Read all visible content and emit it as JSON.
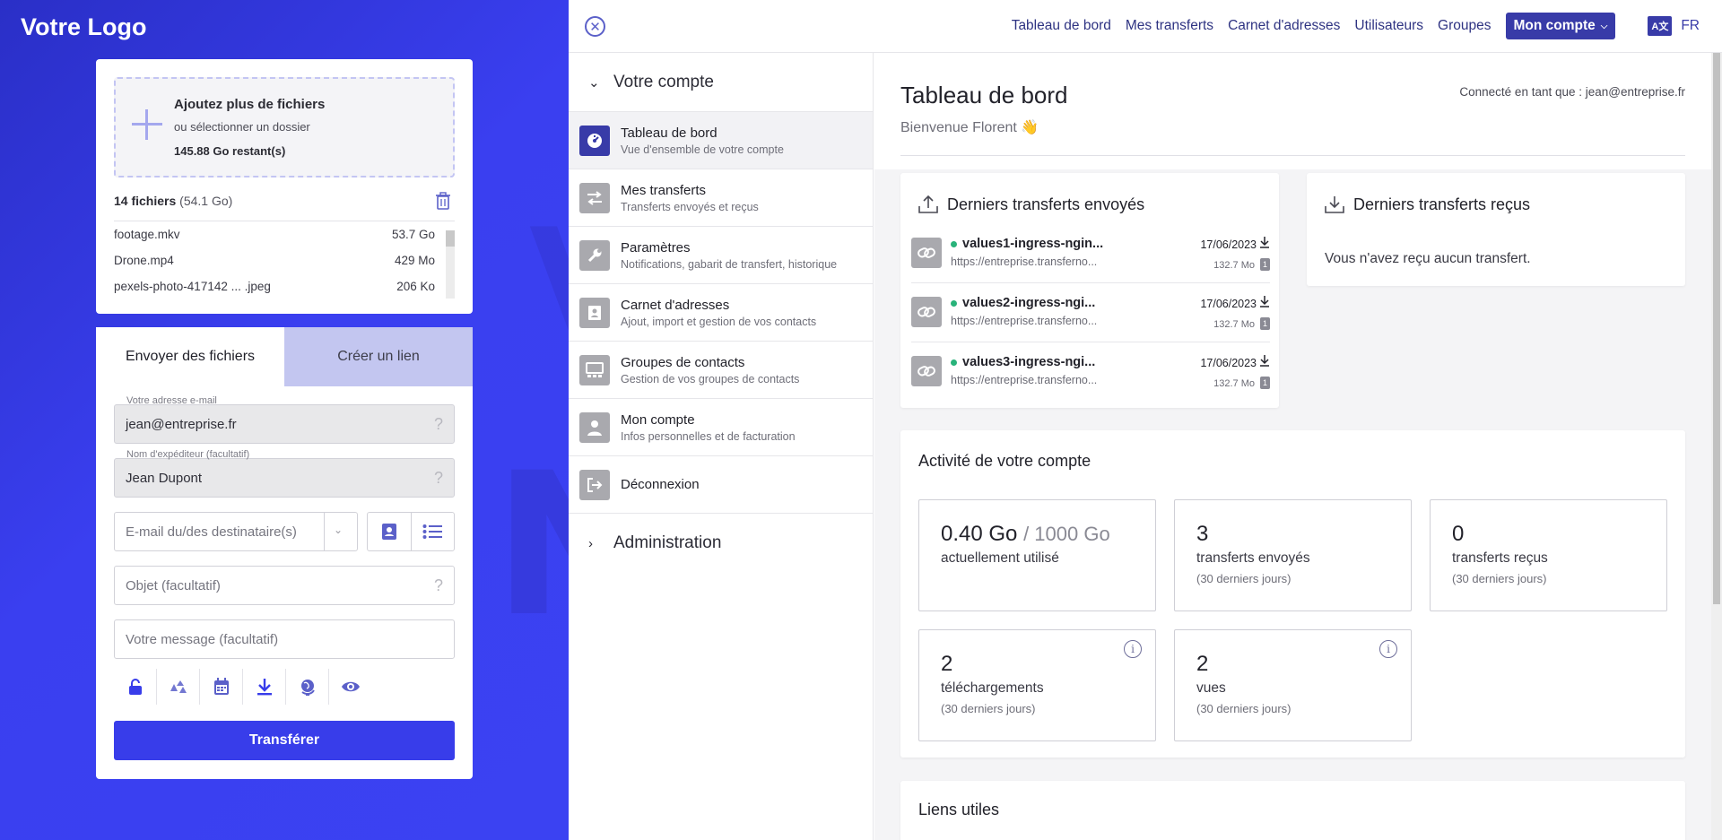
{
  "brand": {
    "logo": "Votre Logo"
  },
  "upload": {
    "title": "Ajoutez plus de fichiers",
    "subtitle": "ou sélectionner un dossier",
    "remaining": "145.88 Go restant(s)",
    "count_bold": "14 fichiers",
    "count_size": "(54.1 Go)",
    "files": [
      {
        "name": "footage.mkv",
        "size": "53.7 Go"
      },
      {
        "name": "Drone.mp4",
        "size": "429 Mo"
      },
      {
        "name": "pexels-photo-417142 ... .jpeg",
        "size": "206 Ko"
      }
    ]
  },
  "send": {
    "tab_send": "Envoyer des fichiers",
    "tab_link": "Créer un lien",
    "email_label": "Votre adresse e-mail",
    "email_value": "jean@entreprise.fr",
    "sender_label": "Nom d'expéditeur (facultatif)",
    "sender_value": "Jean Dupont",
    "recipients_placeholder": "E-mail du/des destinataire(s)",
    "subject_placeholder": "Objet (facultatif)",
    "message_placeholder": "Votre message (facultatif)",
    "submit": "Transférer"
  },
  "topnav": {
    "items": [
      "Tableau de bord",
      "Mes transferts",
      "Carnet d'adresses",
      "Utilisateurs",
      "Groupes"
    ],
    "account": "Mon compte",
    "lang": "FR",
    "lang_icon": "A文"
  },
  "sidebar": {
    "section_account": "Votre compte",
    "section_admin": "Administration",
    "items": [
      {
        "title": "Tableau de bord",
        "sub": "Vue d'ensemble de votre compte",
        "icon": "dashboard-icon"
      },
      {
        "title": "Mes transferts",
        "sub": "Transferts envoyés et reçus",
        "icon": "transfer-icon"
      },
      {
        "title": "Paramètres",
        "sub": "Notifications, gabarit de transfert, historique",
        "icon": "wrench-icon"
      },
      {
        "title": "Carnet d'adresses",
        "sub": "Ajout, import et gestion de vos contacts",
        "icon": "address-book-icon"
      },
      {
        "title": "Groupes de contacts",
        "sub": "Gestion de vos groupes de contacts",
        "icon": "group-icon"
      },
      {
        "title": "Mon compte",
        "sub": "Infos personnelles et de facturation",
        "icon": "user-icon"
      },
      {
        "title": "Déconnexion",
        "sub": "",
        "icon": "logout-icon"
      }
    ]
  },
  "dashboard": {
    "title": "Tableau de bord",
    "welcome": "Bienvenue Florent 👋",
    "connected": "Connecté en tant que : jean@entreprise.fr",
    "sent_title": "Derniers transferts envoyés",
    "received_title": "Derniers transferts reçus",
    "received_empty": "Vous n'avez reçu aucun transfert.",
    "sent": [
      {
        "name": "values1-ingress-ngin...",
        "url": "https://entreprise.transferno...",
        "date": "17/06/2023",
        "size": "132.7 Mo",
        "count": "1"
      },
      {
        "name": "values2-ingress-ngi...",
        "url": "https://entreprise.transferno...",
        "date": "17/06/2023",
        "size": "132.7 Mo",
        "count": "1"
      },
      {
        "name": "values3-ingress-ngi...",
        "url": "https://entreprise.transferno...",
        "date": "17/06/2023",
        "size": "132.7 Mo",
        "count": "1"
      }
    ],
    "activity_title": "Activité de votre compte",
    "stats": {
      "usage_value": "0.40 Go",
      "usage_total": "/ 1000 Go",
      "usage_label": "actuellement utilisé",
      "sent_value": "3",
      "sent_label": "transferts envoyés",
      "sent_period": "(30 derniers jours)",
      "recv_value": "0",
      "recv_label": "transferts reçus",
      "recv_period": "(30 derniers jours)",
      "dl_value": "2",
      "dl_label": "téléchargements",
      "dl_period": "(30 derniers jours)",
      "views_value": "2",
      "views_label": "vues",
      "views_period": "(30 derniers jours)"
    },
    "links_title": "Liens utiles"
  },
  "colors": {
    "accent": "#383dea",
    "navy": "#383ba8",
    "success": "#29b37a"
  }
}
